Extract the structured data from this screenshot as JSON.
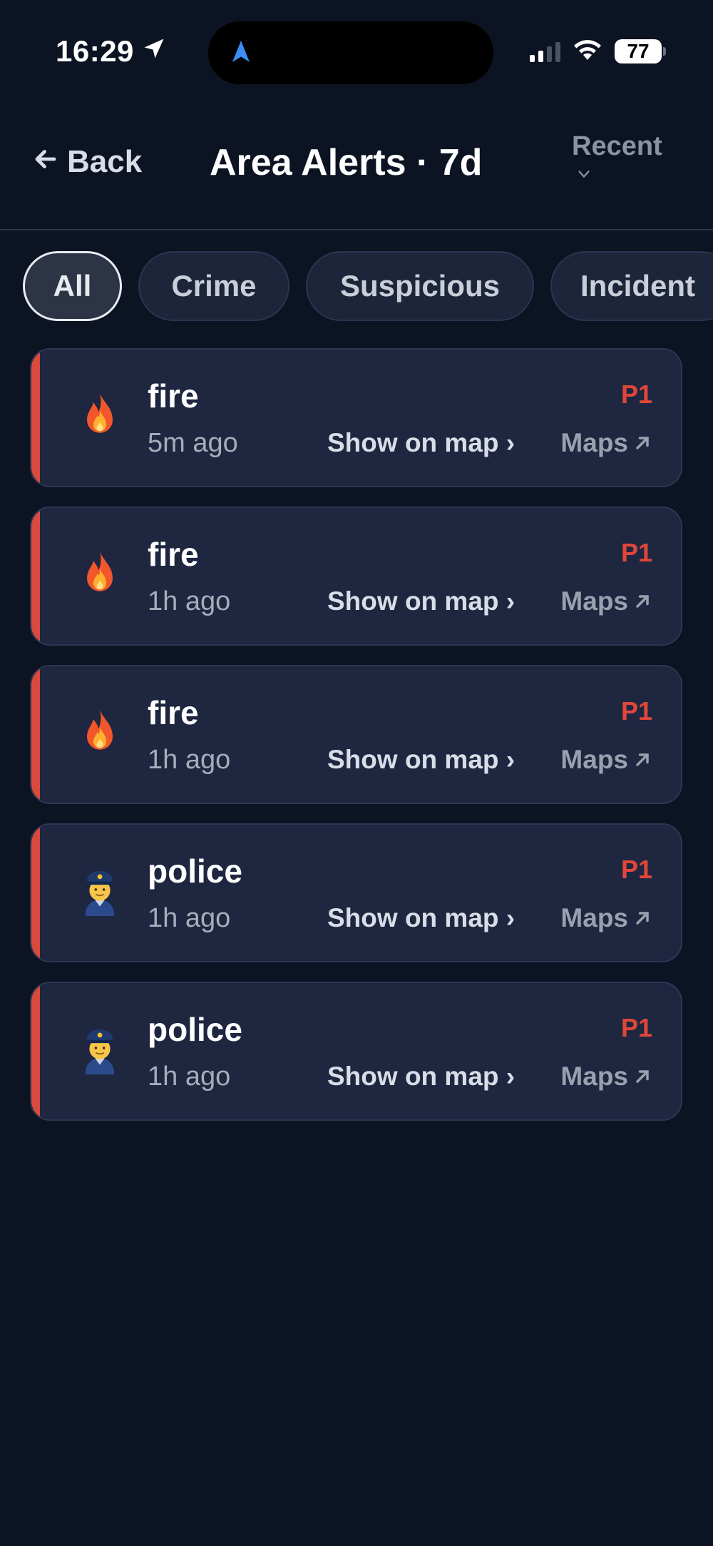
{
  "status_bar": {
    "time": "16:29",
    "battery": "77",
    "icons": [
      "location-arrow-icon",
      "signal-icon",
      "wifi-icon",
      "battery-icon"
    ]
  },
  "header": {
    "back_label": "Back",
    "title": "Area Alerts · 7d",
    "sort_label": "Recent"
  },
  "filters": [
    {
      "label": "All",
      "active": true
    },
    {
      "label": "Crime",
      "active": false
    },
    {
      "label": "Suspicious",
      "active": false
    },
    {
      "label": "Incident",
      "active": false
    }
  ],
  "alerts": [
    {
      "icon": "fire-icon",
      "title": "fire",
      "time": "5m ago",
      "priority": "P1",
      "show_map": "Show on map ›",
      "maps": "Maps"
    },
    {
      "icon": "fire-icon",
      "title": "fire",
      "time": "1h ago",
      "priority": "P1",
      "show_map": "Show on map ›",
      "maps": "Maps"
    },
    {
      "icon": "fire-icon",
      "title": "fire",
      "time": "1h ago",
      "priority": "P1",
      "show_map": "Show on map ›",
      "maps": "Maps"
    },
    {
      "icon": "police-officer-icon",
      "title": "police",
      "time": "1h ago",
      "priority": "P1",
      "show_map": "Show on map ›",
      "maps": "Maps"
    },
    {
      "icon": "police-officer-icon",
      "title": "police",
      "time": "1h ago",
      "priority": "P1",
      "show_map": "Show on map ›",
      "maps": "Maps"
    }
  ],
  "colors": {
    "background": "#0c1322",
    "card": "#1e2640",
    "accent_red": "#d84a3c",
    "priority_red": "#e0473a"
  }
}
